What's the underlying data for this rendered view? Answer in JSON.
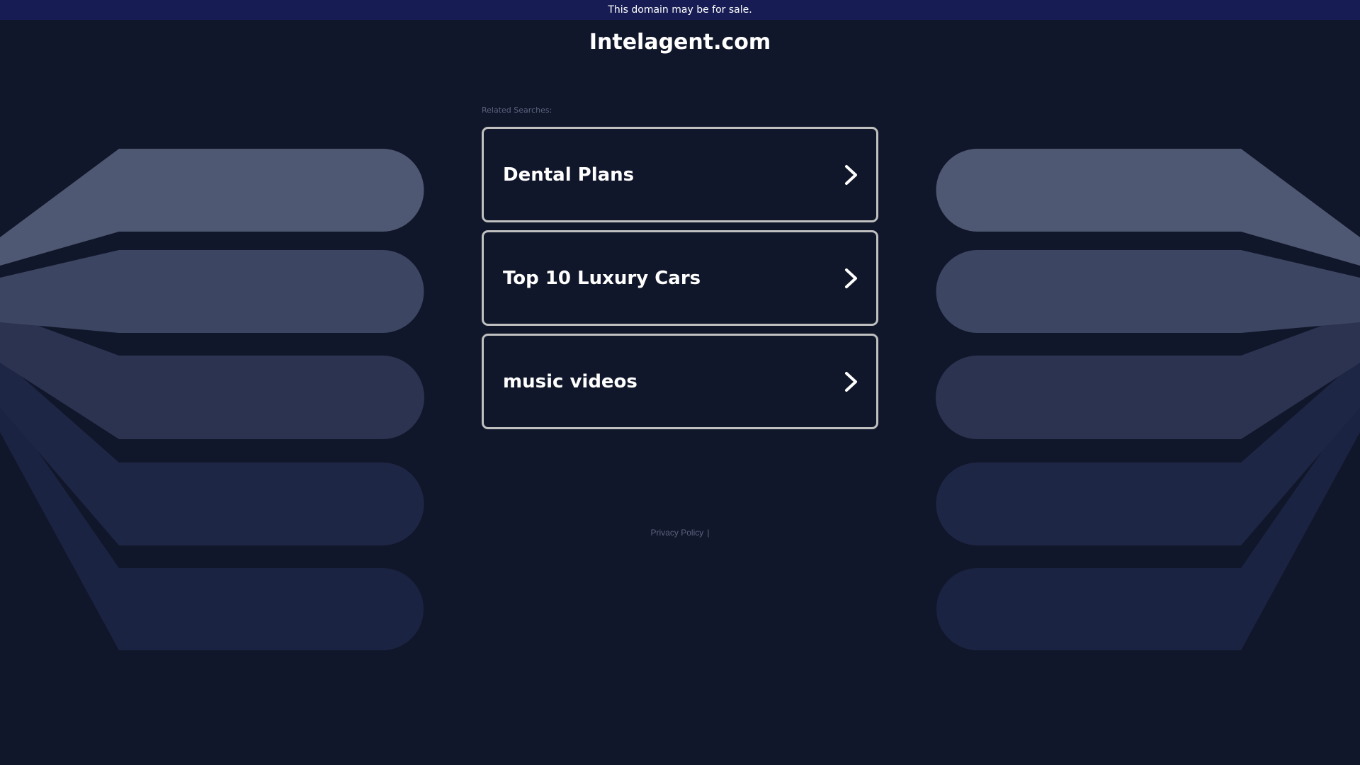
{
  "banner": {
    "text": "This domain may be for sale."
  },
  "domain": {
    "title": "Intelagent.com"
  },
  "related": {
    "label": "Related Searches:",
    "items": [
      {
        "label": "Dental Plans",
        "icon": "chevron-right-icon"
      },
      {
        "label": "Top 10 Luxury Cars",
        "icon": "chevron-right-icon"
      },
      {
        "label": "music videos",
        "icon": "chevron-right-icon"
      }
    ]
  },
  "footer": {
    "privacy_label": "Privacy Policy",
    "separator": "|"
  },
  "colors": {
    "background": "#11172a",
    "banner": "#171d54",
    "card_border": "#c0c0c0",
    "muted_text": "#5a637f",
    "decor_shades": [
      "#4f5873",
      "#3c4562",
      "#2b3350",
      "#1e2645",
      "#1b2342"
    ]
  }
}
